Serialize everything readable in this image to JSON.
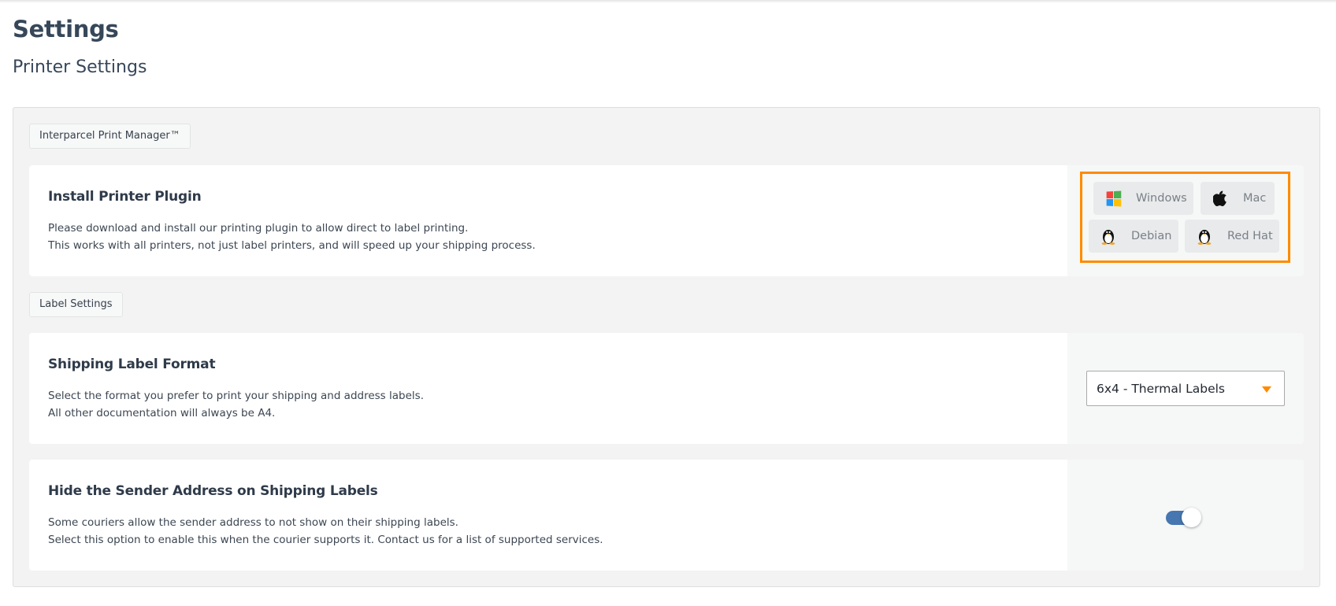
{
  "page": {
    "title": "Settings",
    "subtitle": "Printer Settings"
  },
  "sections": [
    {
      "badge": "Interparcel Print Manager™",
      "cards": [
        {
          "heading": "Install Printer Plugin",
          "lines": [
            "Please download and install our printing plugin to allow direct to label printing.",
            "This works with all printers, not just label printers, and will speed up your shipping process."
          ],
          "os_buttons": [
            {
              "label": "Windows",
              "icon": "windows-icon"
            },
            {
              "label": "Mac",
              "icon": "apple-icon"
            },
            {
              "label": "Debian",
              "icon": "linux-penguin-icon"
            },
            {
              "label": "Red Hat",
              "icon": "linux-penguin-icon"
            }
          ]
        }
      ]
    },
    {
      "badge": "Label Settings",
      "cards": [
        {
          "heading": "Shipping Label Format",
          "lines": [
            "Select the format you prefer to print your shipping and address labels.",
            "All other documentation will always be A4."
          ],
          "select": {
            "selected": "6x4 - Thermal Labels",
            "icon": "caret-down-icon"
          }
        },
        {
          "heading": "Hide the Sender Address on Shipping Labels",
          "lines": [
            "Some couriers allow the sender address to not show on their shipping labels.",
            "Select this option to enable this when the courier supports it. Contact us for a list of supported services."
          ],
          "toggle": {
            "on": true
          }
        }
      ]
    }
  ],
  "colors": {
    "accent": "#ff8a00",
    "toggle_on": "#4677b0",
    "windows_logo": [
      "#f25022",
      "#7fba00",
      "#00a4ef",
      "#ffb900"
    ]
  }
}
